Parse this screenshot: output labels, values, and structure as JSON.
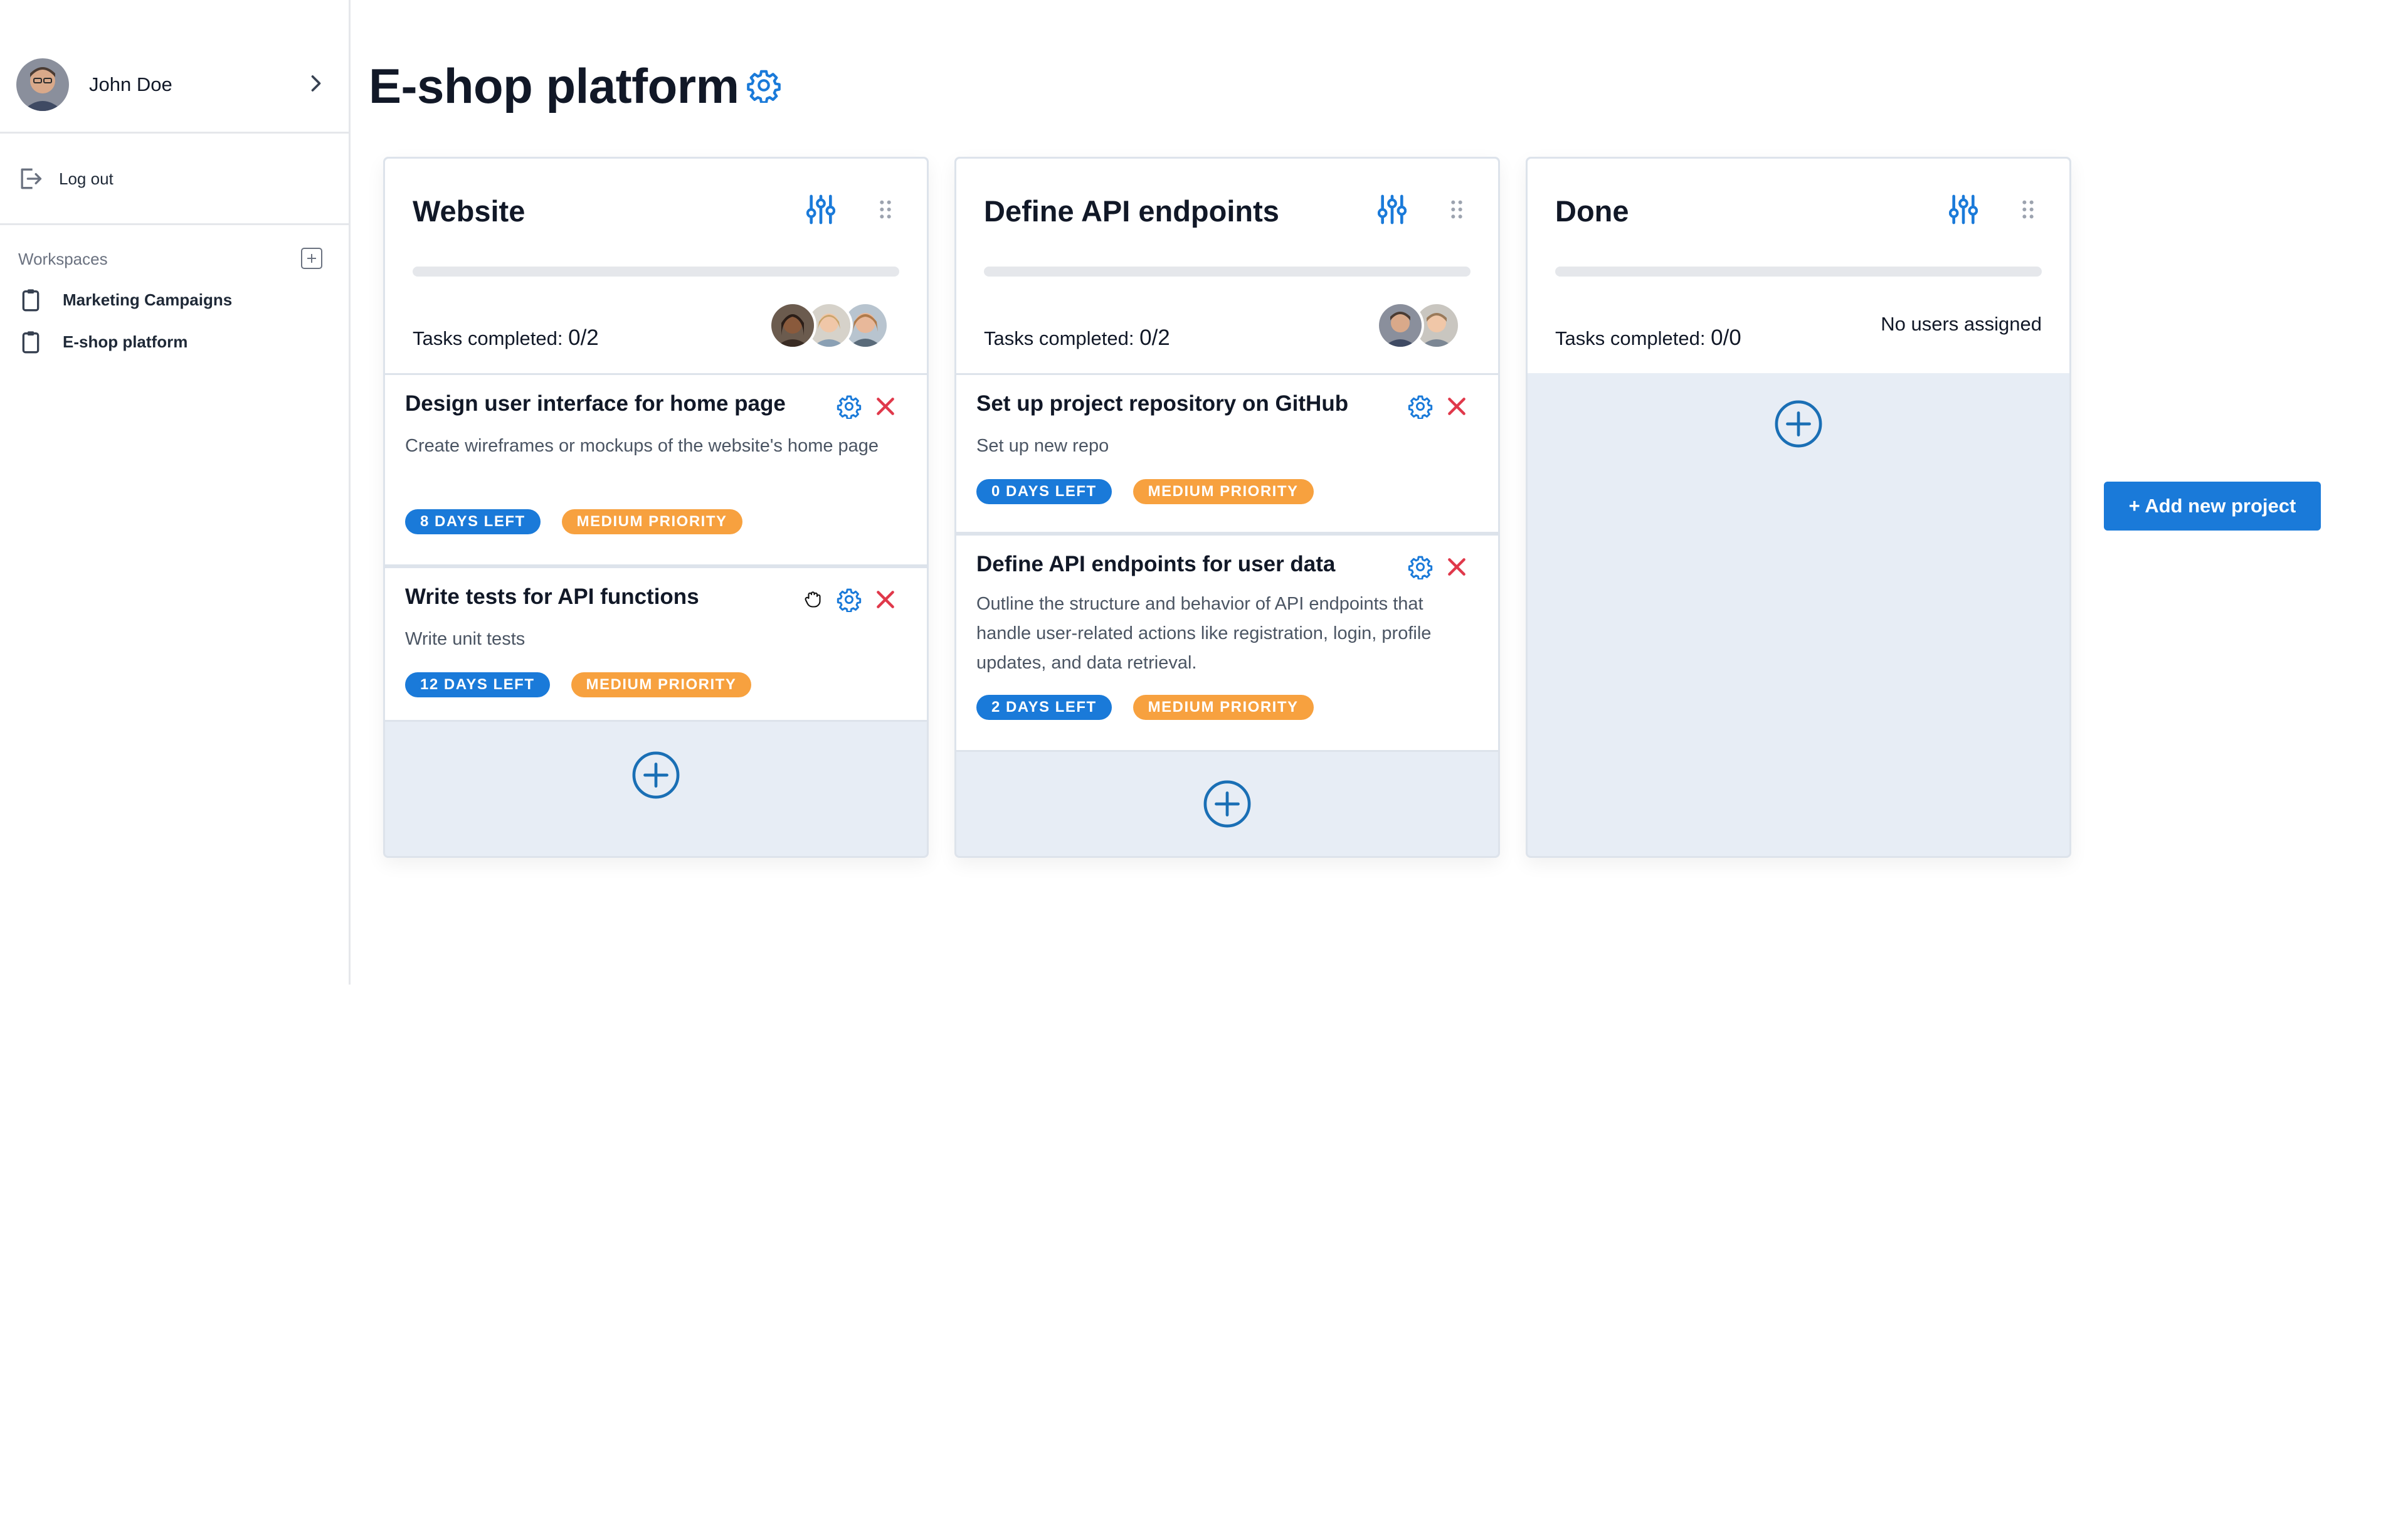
{
  "colors": {
    "accent": "#1a7ad9",
    "danger": "#e0384a",
    "priority": "#f7a13f",
    "column_bg": "#e7edf5"
  },
  "sidebar": {
    "user": {
      "name": "John Doe",
      "avatar_icon": "user-avatar",
      "expand_icon": "chevron-right-icon"
    },
    "logout_label": "Log out",
    "workspaces_label": "Workspaces",
    "workspaces": [
      {
        "label": "Marketing Campaigns",
        "icon": "clipboard-icon"
      },
      {
        "label": "E-shop platform",
        "icon": "clipboard-icon"
      }
    ]
  },
  "header": {
    "title": "E-shop platform",
    "settings_icon": "gear-icon"
  },
  "columns": [
    {
      "title": "Website",
      "tasks_label": "Tasks completed: ",
      "tasks_count": "0/2",
      "progress": 0,
      "assignees": 3,
      "tasks": [
        {
          "title": "Design user interface for home page",
          "description": "Create wireframes or mockups of the website's home page",
          "days_left": "8 DAYS LEFT",
          "priority": "MEDIUM PRIORITY"
        },
        {
          "title": "Write tests for API functions",
          "description": "Write unit tests",
          "days_left": "12 DAYS LEFT",
          "priority": "MEDIUM PRIORITY"
        }
      ]
    },
    {
      "title": "Define API endpoints",
      "tasks_label": "Tasks completed: ",
      "tasks_count": "0/2",
      "progress": 0,
      "assignees": 2,
      "tasks": [
        {
          "title": "Set up project repository on GitHub",
          "description": "Set up new repo",
          "days_left": "0 DAYS LEFT",
          "priority": "MEDIUM PRIORITY"
        },
        {
          "title": "Define API endpoints for user data",
          "description": "Outline the structure and behavior of API endpoints that handle user-related actions like registration, login, profile updates, and data retrieval.",
          "days_left": "2 DAYS LEFT",
          "priority": "MEDIUM PRIORITY"
        }
      ]
    },
    {
      "title": "Done",
      "tasks_label": "Tasks completed: ",
      "tasks_count": "0/0",
      "progress": 0,
      "assignees": 0,
      "no_users_label": "No users assigned",
      "tasks": []
    }
  ],
  "add_project_label": "+ Add new project"
}
